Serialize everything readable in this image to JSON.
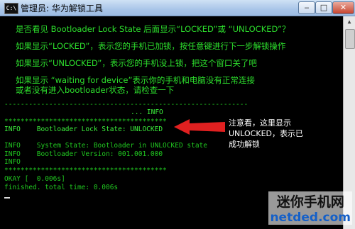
{
  "window": {
    "title": "管理员: 华为解锁工具",
    "app_icon_text": "C:\\"
  },
  "instructions": [
    "是否看见 Bootloader Lock State 后面显示“LOCKED”或 “UNLOCKED”？",
    "如果显示“LOCKED”，表示您的手机已加锁，按任意键进行下一步解锁操作",
    "如果显示“UNLOCKED”，表示您的手机没上锁，把这个窗口关了吧",
    "如果显示 “waiting for device”表示你的手机和电脑没有正常连接",
    "或者没有进入bootloader状态，请检查一下"
  ],
  "console": {
    "separator_dashes": "------------------------------------------------------------",
    "info_header": "... INFO",
    "star_line": "****************************************",
    "lines": [
      "INFO    Bootloader Lock State: UNLOCKED",
      "INFO    System State: Bootloader in UNLOCKED state",
      "INFO    Bootloader Version: 001.001.000",
      "INFO"
    ],
    "okay_line": "OKAY [  0.006s]",
    "finished_line": "finished. total time: 0.006s"
  },
  "annotation": {
    "lines": [
      "注意看，这里显示",
      "UNLOCKED，表示已",
      "成功解锁"
    ],
    "arrow_color": "#e02020"
  },
  "watermark": {
    "line1": "迷你手机网",
    "line2": "netded.com"
  }
}
